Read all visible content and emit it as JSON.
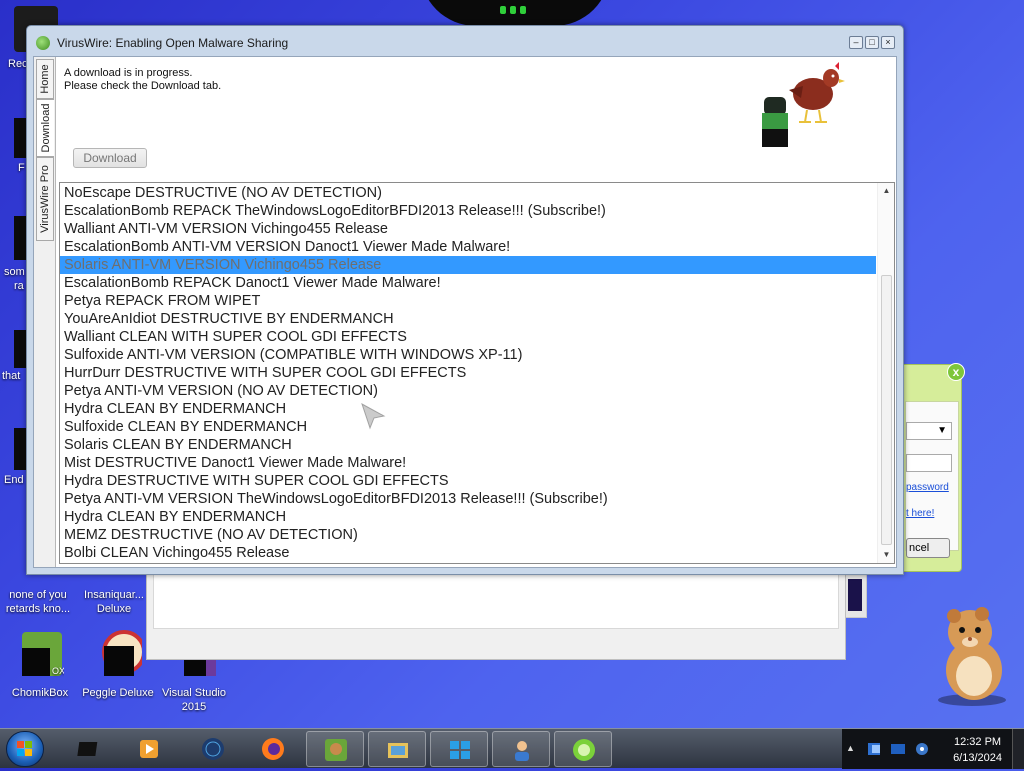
{
  "desktop": {
    "icons": [
      {
        "label": "Rec",
        "name": "recycle-bin"
      },
      {
        "label": "none of you retards kno...",
        "name": "text-file"
      },
      {
        "label": "Insaniquar... Deluxe",
        "name": "insaniquarium"
      },
      {
        "label": "ChomikBox",
        "name": "chomikbox"
      },
      {
        "label": "Peggle Deluxe",
        "name": "peggle-deluxe"
      },
      {
        "label": "Visual Studio 2015",
        "name": "visual-studio"
      }
    ],
    "edge_labels": [
      "F",
      "som",
      "ra",
      "that",
      "End"
    ]
  },
  "window": {
    "title": "VirusWire: Enabling Open Malware Sharing",
    "tabs": [
      "Home",
      "Download",
      "VirusWire Pro"
    ],
    "active_tab": "Download",
    "message_line1": "A download is in progress.",
    "message_line2": "Please check the Download tab.",
    "download_button": "Download",
    "list_items": [
      "NoEscape DESTRUCTIVE (NO AV DETECTION)",
      "EscalationBomb REPACK TheWindowsLogoEditorBFDI2013 Release!!! (Subscribe!)",
      "Walliant ANTI-VM VERSION Vichingo455 Release",
      "EscalationBomb ANTI-VM VERSION Danoct1 Viewer Made Malware!",
      "Solaris ANTI-VM VERSION Vichingo455 Release",
      "EscalationBomb REPACK Danoct1 Viewer Made Malware!",
      "Petya REPACK FROM WIPET",
      "YouAreAnIdiot DESTRUCTIVE BY ENDERMANCH",
      "Walliant CLEAN WITH SUPER COOL GDI EFFECTS",
      "Sulfoxide ANTI-VM VERSION (COMPATIBLE WITH WINDOWS XP-11)",
      "HurrDurr DESTRUCTIVE WITH SUPER COOL GDI EFFECTS",
      "Petya ANTI-VM VERSION (NO AV DETECTION)",
      "Hydra CLEAN BY ENDERMANCH",
      "Sulfoxide CLEAN BY ENDERMANCH",
      "Solaris CLEAN BY ENDERMANCH",
      "Mist DESTRUCTIVE Danoct1 Viewer Made Malware!",
      "Hydra DESTRUCTIVE WITH SUPER COOL GDI EFFECTS",
      "Petya ANTI-VM VERSION TheWindowsLogoEditorBFDI2013 Release!!! (Subscribe!)",
      "Hydra CLEAN BY ENDERMANCH",
      "MEMZ DESTRUCTIVE (NO AV DETECTION)",
      "Bolbi CLEAN Vichingo455 Release"
    ],
    "selected_index": 4
  },
  "green_dialog": {
    "close": "x",
    "link1": "password",
    "link2": "t here!",
    "button": "ncel"
  },
  "taskbar": {
    "time": "12:32 PM",
    "date": "6/13/2024",
    "apps": [
      "media-player",
      "globe",
      "firefox",
      "chomikbox",
      "file-manager",
      "windows-store",
      "user-app",
      "lime-app"
    ]
  },
  "colors": {
    "selection": "#3399ff",
    "desktop": "#3b48e0"
  }
}
